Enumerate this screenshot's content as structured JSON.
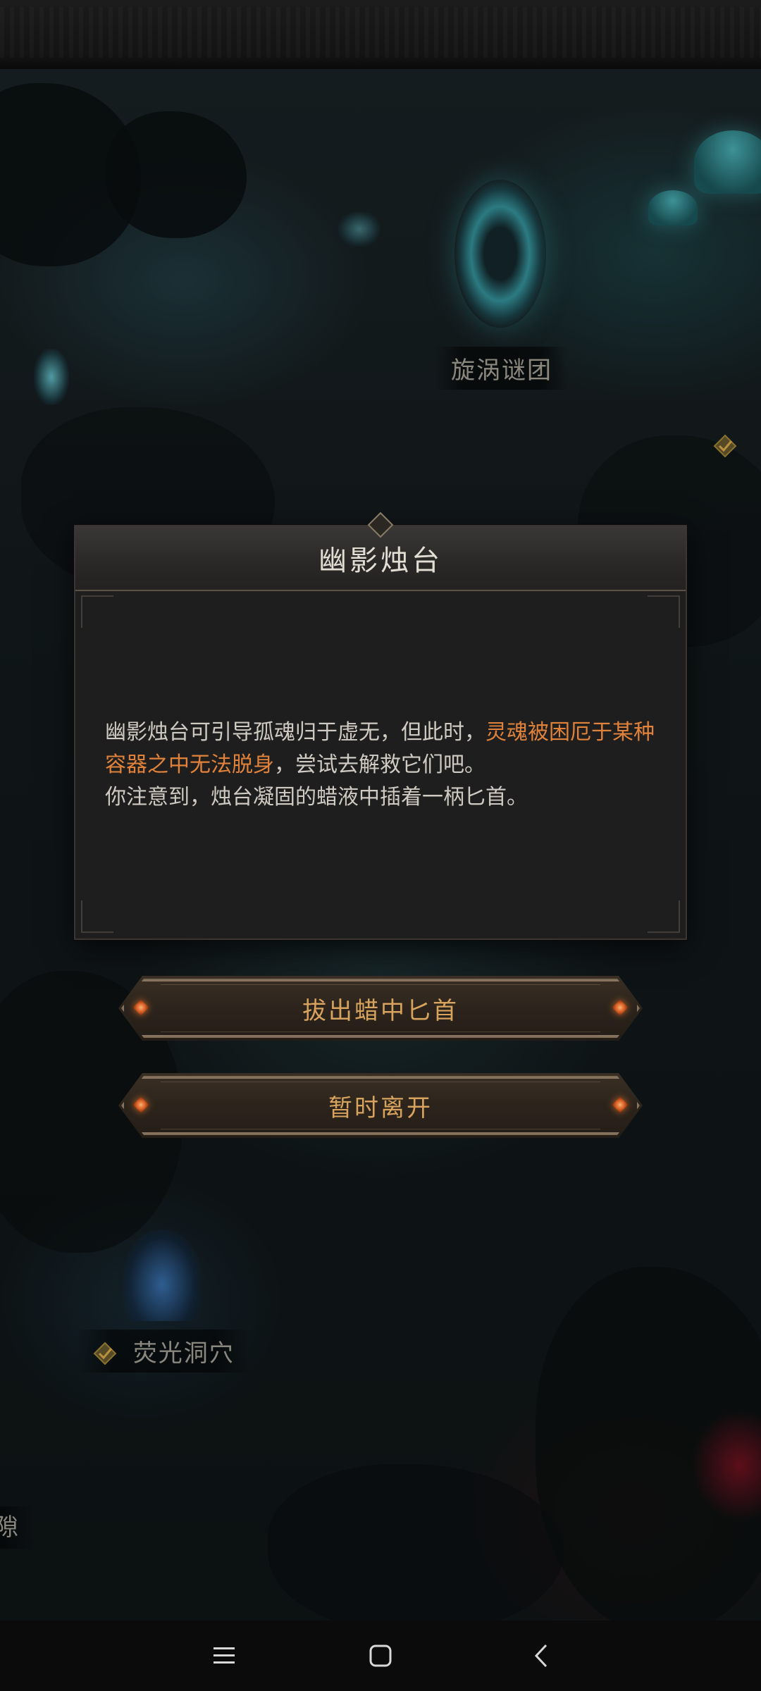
{
  "scene": {
    "labels": {
      "vortex_puzzle": "旋涡谜团",
      "glowing_cave": "荧光洞穴",
      "left_edge_partial": "隙"
    }
  },
  "dialog": {
    "title": "幽影烛台",
    "body_part1": "幽影烛台可引导孤魂归于虚无，但此时，",
    "body_highlight": "灵魂被困厄于某种容器之中无法脱身",
    "body_part2": "，尝试去解救它们吧。",
    "body_line2": "你注意到，烛台凝固的蜡液中插着一柄匕首。",
    "highlight_color": "#e0823a"
  },
  "options": [
    {
      "label": "拔出蜡中匕首"
    },
    {
      "label": "暂时离开"
    }
  ],
  "navbar": {
    "icons": [
      "menu-icon",
      "home-icon",
      "back-icon"
    ]
  }
}
